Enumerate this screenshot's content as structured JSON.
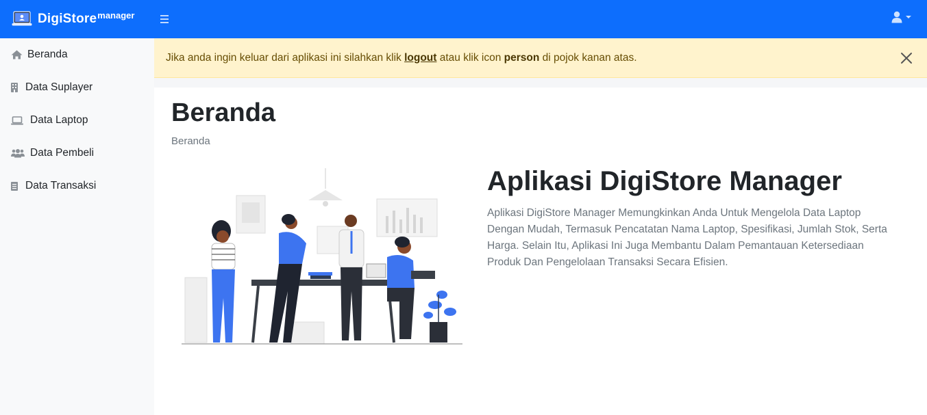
{
  "brand": {
    "name": "DigiStore",
    "suffix": "manager"
  },
  "sidebar": {
    "items": [
      {
        "label": "Beranda",
        "icon": "home-icon"
      },
      {
        "label": "Data Suplayer",
        "icon": "building-icon"
      },
      {
        "label": "Data Laptop",
        "icon": "laptop-icon"
      },
      {
        "label": "Data Pembeli",
        "icon": "users-icon"
      },
      {
        "label": "Data Transaksi",
        "icon": "document-icon"
      }
    ]
  },
  "alert": {
    "text_before": "Jika anda ingin keluar dari aplikasi ini silahkan klik ",
    "logout_link": "logout",
    "text_middle": " atau klik icon ",
    "person_word": "person",
    "text_after": " di pojok kanan atas."
  },
  "page": {
    "title": "Beranda",
    "breadcrumb": "Beranda"
  },
  "hero": {
    "title": "Aplikasi DigiStore Manager",
    "text": "Aplikasi DigiStore Manager Memungkinkan Anda Untuk Mengelola Data Laptop Dengan Mudah, Termasuk Pencatatan Nama Laptop, Spesifikasi, Jumlah Stok, Serta Harga. Selain Itu, Aplikasi Ini Juga Membantu Dalam Pemantauan Ketersediaan Produk Dan Pengelolaan Transaksi Secara Efisien."
  },
  "colors": {
    "primary": "#0d6efd",
    "alert_bg": "#fff3cd",
    "accent_blue": "#3d74f0"
  }
}
